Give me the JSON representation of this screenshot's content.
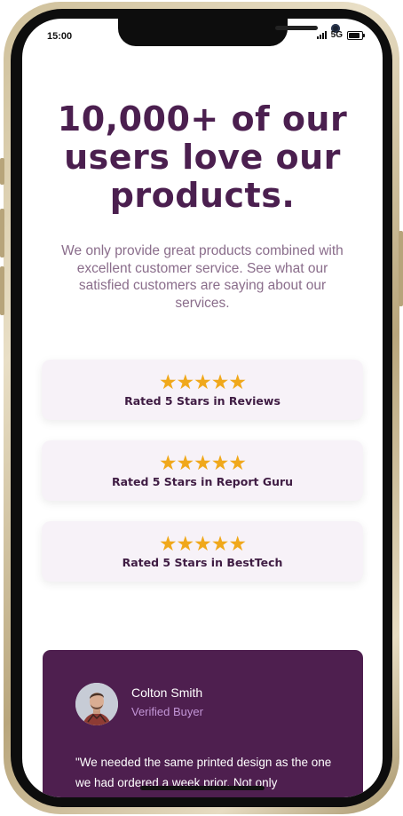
{
  "status_bar": {
    "time": "15:00",
    "network": "5G"
  },
  "hero": {
    "headline": "10,000+ of our users love our products.",
    "subtext": "We only provide great products combined with excellent customer service. See what our satisfied customers are saying about our services."
  },
  "ratings": [
    {
      "stars": "★★★★★",
      "rating": 5,
      "label": "Rated 5 Stars in Reviews"
    },
    {
      "stars": "★★★★★",
      "rating": 5,
      "label": "Rated 5 Stars in Report Guru"
    },
    {
      "stars": "★★★★★",
      "rating": 5,
      "label": "Rated 5 Stars in BestTech"
    }
  ],
  "testimonial": {
    "name": "Colton Smith",
    "role": "Verified Buyer",
    "quote": "\"We needed the same printed design as the one we had ordered a week prior. Not only"
  },
  "colors": {
    "primary": "#4b1f4f",
    "star": "#f0a81b",
    "card_bg": "#f7f2f8",
    "muted_text": "#8a6d8b",
    "role_text": "#c295d6"
  },
  "icons": {
    "signal": "cellular-signal-icon",
    "battery": "battery-icon",
    "star": "star-icon"
  }
}
